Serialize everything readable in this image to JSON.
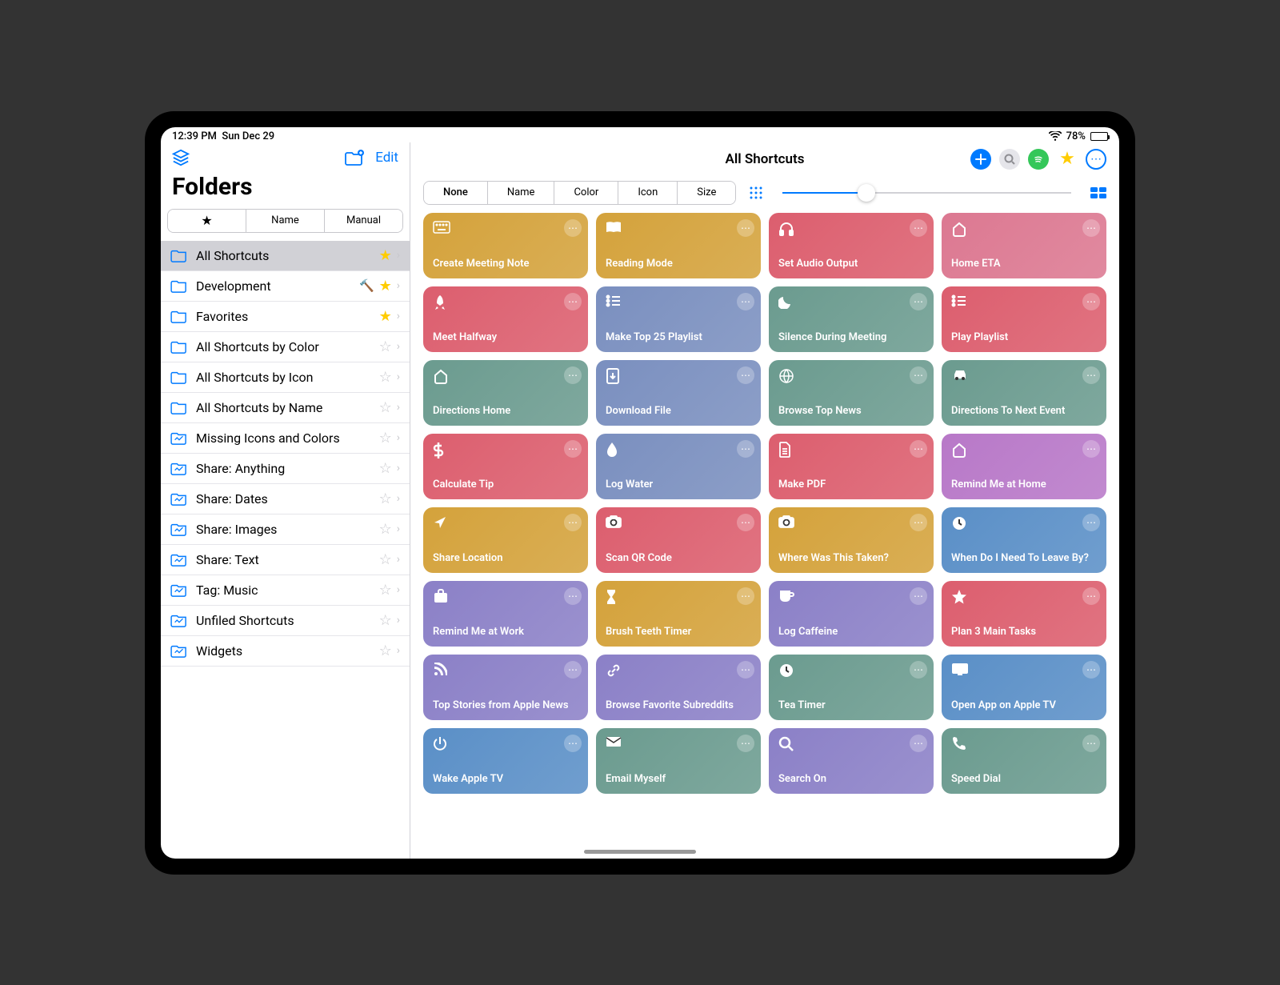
{
  "status": {
    "time": "12:39 PM",
    "date": "Sun Dec 29",
    "battery": "78%"
  },
  "sidebar": {
    "title": "Folders",
    "edit": "Edit",
    "sort_tabs": [
      "★",
      "Name",
      "Manual"
    ],
    "items": [
      {
        "label": "All Shortcuts",
        "starred": true,
        "selected": true,
        "icon": "folder"
      },
      {
        "label": "Development",
        "starred": true,
        "hammer": true,
        "icon": "folder"
      },
      {
        "label": "Favorites",
        "starred": true,
        "icon": "folder"
      },
      {
        "label": "All Shortcuts by Color",
        "starred": false,
        "icon": "folder"
      },
      {
        "label": "All Shortcuts by Icon",
        "starred": false,
        "icon": "folder"
      },
      {
        "label": "All Shortcuts by Name",
        "starred": false,
        "icon": "folder"
      },
      {
        "label": "Missing Icons and Colors",
        "starred": false,
        "icon": "smart"
      },
      {
        "label": "Share: Anything",
        "starred": false,
        "icon": "smart"
      },
      {
        "label": "Share: Dates",
        "starred": false,
        "icon": "smart"
      },
      {
        "label": "Share: Images",
        "starred": false,
        "icon": "smart"
      },
      {
        "label": "Share: Text",
        "starred": false,
        "icon": "smart"
      },
      {
        "label": "Tag: Music",
        "starred": false,
        "icon": "smart"
      },
      {
        "label": "Unfiled Shortcuts",
        "starred": false,
        "icon": "smart"
      },
      {
        "label": "Widgets",
        "starred": false,
        "icon": "smart"
      }
    ]
  },
  "main": {
    "title": "All Shortcuts",
    "sort_tabs": [
      "None",
      "Name",
      "Color",
      "Icon",
      "Size"
    ]
  },
  "shortcuts": [
    {
      "label": "Create Meeting Note",
      "color": "#d4a23b",
      "icon": "keyboard"
    },
    {
      "label": "Reading Mode",
      "color": "#d4a23b",
      "icon": "book"
    },
    {
      "label": "Set Audio Output",
      "color": "#dc5e6e",
      "icon": "headphones"
    },
    {
      "label": "Home ETA",
      "color": "#dc7891",
      "icon": "home"
    },
    {
      "label": "Meet Halfway",
      "color": "#dc5e6e",
      "icon": "rocket"
    },
    {
      "label": "Make Top 25 Playlist",
      "color": "#7a8fbf",
      "icon": "list"
    },
    {
      "label": "Silence During Meeting",
      "color": "#6b9b8f",
      "icon": "moon"
    },
    {
      "label": "Play Playlist",
      "color": "#dc5e6e",
      "icon": "list"
    },
    {
      "label": "Directions Home",
      "color": "#6b9b8f",
      "icon": "home"
    },
    {
      "label": "Download File",
      "color": "#7a8fbf",
      "icon": "download"
    },
    {
      "label": "Browse Top News",
      "color": "#6b9b8f",
      "icon": "globe"
    },
    {
      "label": "Directions To Next Event",
      "color": "#6b9b8f",
      "icon": "car"
    },
    {
      "label": "Calculate Tip",
      "color": "#dc5e6e",
      "icon": "dollar"
    },
    {
      "label": "Log Water",
      "color": "#7a8fbf",
      "icon": "drop"
    },
    {
      "label": "Make PDF",
      "color": "#dc5e6e",
      "icon": "document"
    },
    {
      "label": "Remind Me at Home",
      "color": "#b878c8",
      "icon": "home"
    },
    {
      "label": "Share Location",
      "color": "#d4a23b",
      "icon": "location"
    },
    {
      "label": "Scan QR Code",
      "color": "#dc5e6e",
      "icon": "camera"
    },
    {
      "label": "Where Was This Taken?",
      "color": "#d4a23b",
      "icon": "camera"
    },
    {
      "label": "When Do I Need To Leave By?",
      "color": "#5a8fc7",
      "icon": "clock"
    },
    {
      "label": "Remind Me at Work",
      "color": "#8b80c7",
      "icon": "briefcase"
    },
    {
      "label": "Brush Teeth Timer",
      "color": "#d4a23b",
      "icon": "hourglass"
    },
    {
      "label": "Log Caffeine",
      "color": "#8b80c7",
      "icon": "cup"
    },
    {
      "label": "Plan 3 Main Tasks",
      "color": "#dc5e6e",
      "icon": "star"
    },
    {
      "label": "Top Stories from Apple News",
      "color": "#8b80c7",
      "icon": "rss"
    },
    {
      "label": "Browse Favorite Subreddits",
      "color": "#8b80c7",
      "icon": "link"
    },
    {
      "label": "Tea Timer",
      "color": "#6b9b8f",
      "icon": "clock"
    },
    {
      "label": "Open App on Apple TV",
      "color": "#5a8fc7",
      "icon": "monitor"
    },
    {
      "label": "Wake Apple TV",
      "color": "#5a8fc7",
      "icon": "power"
    },
    {
      "label": "Email Myself",
      "color": "#6b9b8f",
      "icon": "mail"
    },
    {
      "label": "Search On",
      "color": "#8b80c7",
      "icon": "search"
    },
    {
      "label": "Speed Dial",
      "color": "#6b9b8f",
      "icon": "phone"
    }
  ],
  "icons": {
    "keyboard": "⌨",
    "book": "▬",
    "headphones": "🎧",
    "home": "⌂",
    "rocket": "➤",
    "list": "☰",
    "moon": "☾",
    "download": "⬇",
    "globe": "⊕",
    "car": "🚗",
    "dollar": "$",
    "drop": "💧",
    "document": "▤",
    "location": "➤",
    "camera": "📷",
    "clock": "◷",
    "briefcase": "💼",
    "hourglass": "⧗",
    "cup": "☕",
    "star": "★",
    "rss": "▲",
    "link": "🔗",
    "monitor": "▭",
    "power": "⏻",
    "mail": "✉",
    "search": "🔍",
    "phone": "📞"
  }
}
